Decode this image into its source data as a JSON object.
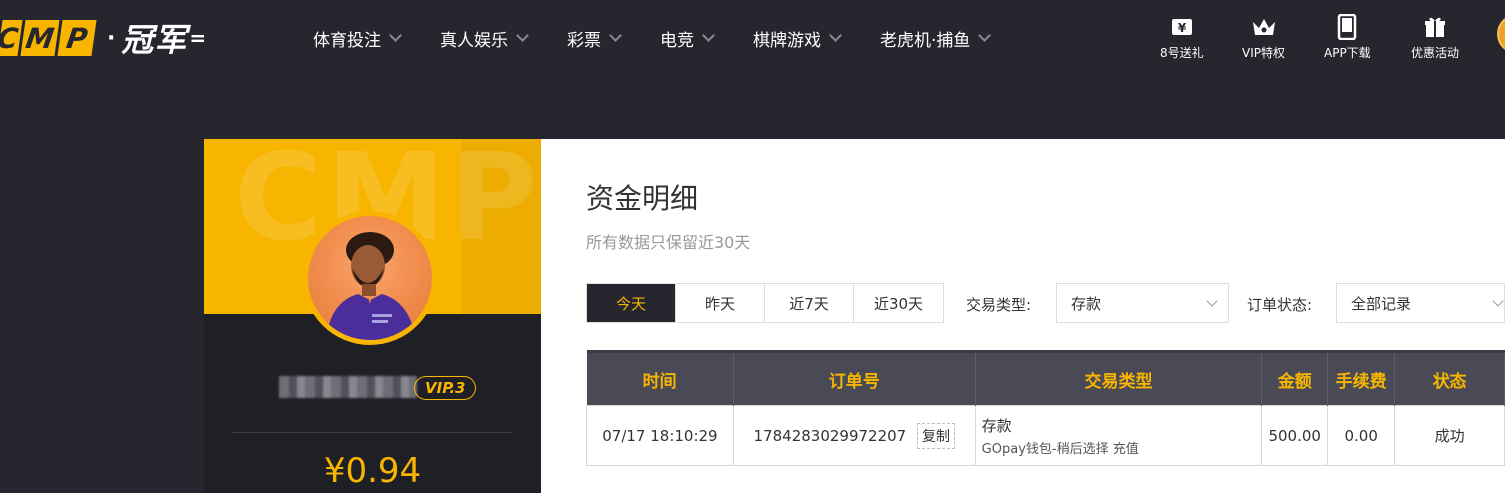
{
  "header": {
    "logo_letters": [
      "C",
      "M",
      "P"
    ],
    "logo_cn": "冠军",
    "nav": [
      {
        "label": "体育投注"
      },
      {
        "label": "真人娱乐"
      },
      {
        "label": "彩票"
      },
      {
        "label": "电竞"
      },
      {
        "label": "棋牌游戏"
      },
      {
        "label": "老虎机·捕鱼"
      }
    ],
    "quick_links": [
      {
        "label": "8号送礼",
        "icon": "ticket-icon"
      },
      {
        "label": "VIP特权",
        "icon": "crown-icon"
      },
      {
        "label": "APP下载",
        "icon": "phone-icon"
      },
      {
        "label": "优惠活动",
        "icon": "gift-icon"
      }
    ]
  },
  "profile": {
    "vip": "VIP.3",
    "balance": "¥0.94"
  },
  "main": {
    "title": "资金明细",
    "subtitle": "所有数据只保留近30天",
    "tabs": [
      {
        "label": "今天",
        "active": true
      },
      {
        "label": "昨天",
        "active": false
      },
      {
        "label": "近7天",
        "active": false
      },
      {
        "label": "近30天",
        "active": false
      }
    ],
    "filters": {
      "type_label": "交易类型:",
      "type_value": "存款",
      "status_label": "订单状态:",
      "status_value": "全部记录"
    },
    "table": {
      "columns": [
        "时间",
        "订单号",
        "交易类型",
        "金额",
        "手续费",
        "状态"
      ],
      "rows": [
        {
          "time": "07/17 18:10:29",
          "order_no": "1784283029972207",
          "copy_label": "复制",
          "type_main": "存款",
          "type_sub": "GOpay钱包-稍后选择 充值",
          "amount": "500.00",
          "fee": "0.00",
          "status": "成功"
        }
      ]
    }
  },
  "colors": {
    "brand": "#f7b500",
    "dark_bg": "#26262f",
    "success": "#3aa34c"
  }
}
